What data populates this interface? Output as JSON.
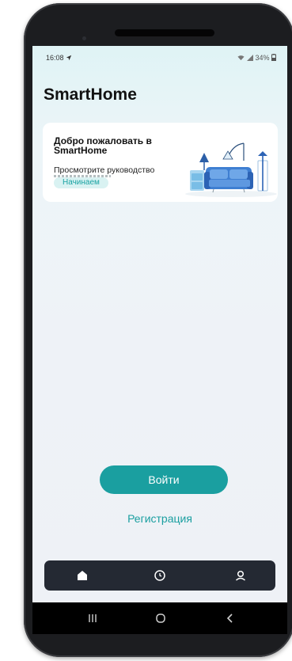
{
  "status_bar": {
    "time": "16:08",
    "battery": "34%"
  },
  "app": {
    "title": "SmartHome"
  },
  "welcome_card": {
    "title": "Добро пожаловать в SmartHome",
    "description": "Просмотрите руководство",
    "badge": "Начинаем"
  },
  "actions": {
    "login": "Войти",
    "register": "Регистрация"
  },
  "bottom_nav": {
    "items": [
      {
        "icon": "home-icon",
        "active": true
      },
      {
        "icon": "clock-icon",
        "active": false
      },
      {
        "icon": "user-icon",
        "active": false
      }
    ]
  },
  "system_nav": {
    "icons": [
      "recents-icon",
      "home-circle-icon",
      "back-icon"
    ]
  },
  "colors": {
    "accent": "#1a9fa0",
    "nav_bg": "#242933",
    "badge_bg": "#d9f2f2"
  }
}
